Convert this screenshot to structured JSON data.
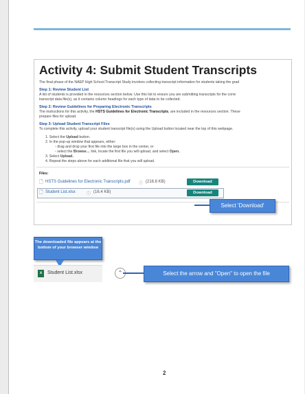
{
  "activity": {
    "title": "Activity 4:  Submit Student Transcripts",
    "intro": "The final phase of the NAEP High School Transcript Study involves collecting transcript information for students taking the grad",
    "step1": {
      "heading": "Step 1:  Review Student List",
      "line1": "A list of students is provided in the resources section below. Use this list to ensure you are submitting transcripts for the corre",
      "line2": "transcript data file(s), as it contains column headings for each type of data to be collected."
    },
    "step2": {
      "heading": "Step 2:  Review Guidelines for Preparing Electronic Transcripts",
      "line1_pre": "The instructions for this activity, the ",
      "line1_bold": "HSTS Guidelines for Electronic Transcripts",
      "line1_post": ", are included in the resources section. These",
      "line2": "prepare files for upload."
    },
    "step3": {
      "heading": "Step 3:  Upload Student Transcript Files",
      "line1": "To complete this activity, upload your student transcript file(s) using the Upload button located near the top of this webpage.",
      "item1_pre": "1. Select the ",
      "item1_bold": "Upload",
      "item1_post": " button.",
      "item2": "2. In the pop-up window that appears, either:",
      "sub1": "drag and drop your first file into the large box in the center, or",
      "sub2_pre": "select the ",
      "sub2_bold": "Browse…",
      "sub2_mid": " link, locate the first file you will upload, and select ",
      "sub2_bold2": "Open.",
      "item3_pre": "3. Select ",
      "item3_bold": "Upload.",
      "item4": "4. Repeat the steps above for each additional file that you will upload."
    },
    "files_label": "Files:",
    "files": [
      {
        "name": "HSTS Guidelines for Electronic Transcripts.pdf",
        "size": "(216.8 KB)",
        "button": "Download"
      },
      {
        "name": "Student List.xlsx",
        "size": "(16.4 KB)",
        "button": "Download"
      }
    ]
  },
  "callouts": {
    "select_download": "Select 'Download'",
    "downloaded_tip": "The downloaded file appears at the bottom of your browser window",
    "select_arrow": "Select the arrow and \"Open\" to open the file"
  },
  "download_bar": {
    "filename": "Student List.xlsx"
  },
  "page_number": "2",
  "colors": {
    "accent_rule": "#7fb6d6",
    "download_button": "#17857c",
    "callout": "#4a86d8",
    "heading_blue": "#1f4e9a"
  }
}
